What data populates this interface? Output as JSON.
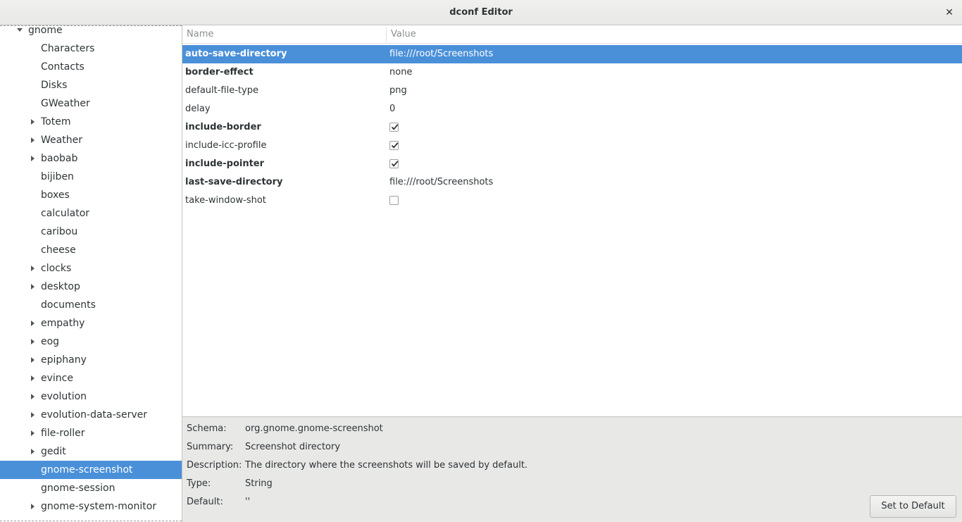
{
  "window": {
    "title": "dconf Editor"
  },
  "tree": {
    "items": [
      {
        "label": "gnome",
        "expander": "down",
        "indent": 0
      },
      {
        "label": "Characters",
        "expander": "none",
        "indent": 1
      },
      {
        "label": "Contacts",
        "expander": "none",
        "indent": 1
      },
      {
        "label": "Disks",
        "expander": "none",
        "indent": 1
      },
      {
        "label": "GWeather",
        "expander": "none",
        "indent": 1
      },
      {
        "label": "Totem",
        "expander": "right",
        "indent": 1
      },
      {
        "label": "Weather",
        "expander": "right",
        "indent": 1
      },
      {
        "label": "baobab",
        "expander": "right",
        "indent": 1
      },
      {
        "label": "bijiben",
        "expander": "none",
        "indent": 1
      },
      {
        "label": "boxes",
        "expander": "none",
        "indent": 1
      },
      {
        "label": "calculator",
        "expander": "none",
        "indent": 1
      },
      {
        "label": "caribou",
        "expander": "none",
        "indent": 1
      },
      {
        "label": "cheese",
        "expander": "none",
        "indent": 1
      },
      {
        "label": "clocks",
        "expander": "right",
        "indent": 1
      },
      {
        "label": "desktop",
        "expander": "right",
        "indent": 1
      },
      {
        "label": "documents",
        "expander": "none",
        "indent": 1
      },
      {
        "label": "empathy",
        "expander": "right",
        "indent": 1
      },
      {
        "label": "eog",
        "expander": "right",
        "indent": 1
      },
      {
        "label": "epiphany",
        "expander": "right",
        "indent": 1
      },
      {
        "label": "evince",
        "expander": "right",
        "indent": 1
      },
      {
        "label": "evolution",
        "expander": "right",
        "indent": 1
      },
      {
        "label": "evolution-data-server",
        "expander": "right",
        "indent": 1
      },
      {
        "label": "file-roller",
        "expander": "right",
        "indent": 1
      },
      {
        "label": "gedit",
        "expander": "right",
        "indent": 1
      },
      {
        "label": "gnome-screenshot",
        "expander": "none",
        "indent": 1,
        "selected": true
      },
      {
        "label": "gnome-session",
        "expander": "none",
        "indent": 1
      },
      {
        "label": "gnome-system-monitor",
        "expander": "right",
        "indent": 1
      }
    ]
  },
  "keys": {
    "columns": {
      "name": "Name",
      "value": "Value"
    },
    "rows": [
      {
        "name": "auto-save-directory",
        "bold": true,
        "type": "text",
        "value": "file:///root/Screenshots",
        "selected": true
      },
      {
        "name": "border-effect",
        "bold": true,
        "type": "text",
        "value": "none"
      },
      {
        "name": "default-file-type",
        "bold": false,
        "type": "text",
        "value": "png"
      },
      {
        "name": "delay",
        "bold": false,
        "type": "text",
        "value": "0"
      },
      {
        "name": "include-border",
        "bold": true,
        "type": "check",
        "checked": true
      },
      {
        "name": "include-icc-profile",
        "bold": false,
        "type": "check",
        "checked": true
      },
      {
        "name": "include-pointer",
        "bold": true,
        "type": "check",
        "checked": true
      },
      {
        "name": "last-save-directory",
        "bold": true,
        "type": "text",
        "value": "file:///root/Screenshots"
      },
      {
        "name": "take-window-shot",
        "bold": false,
        "type": "check",
        "checked": false
      }
    ]
  },
  "info": {
    "schema_label": "Schema:",
    "schema": "org.gnome.gnome-screenshot",
    "summary_label": "Summary:",
    "summary": "Screenshot directory",
    "description_label": "Description:",
    "description": "The directory where the screenshots will be saved by default.",
    "type_label": "Type:",
    "type": "String",
    "default_label": "Default:",
    "default": "''",
    "set_default_label": "Set to Default"
  },
  "colors": {
    "accent": "#4a90d9"
  }
}
